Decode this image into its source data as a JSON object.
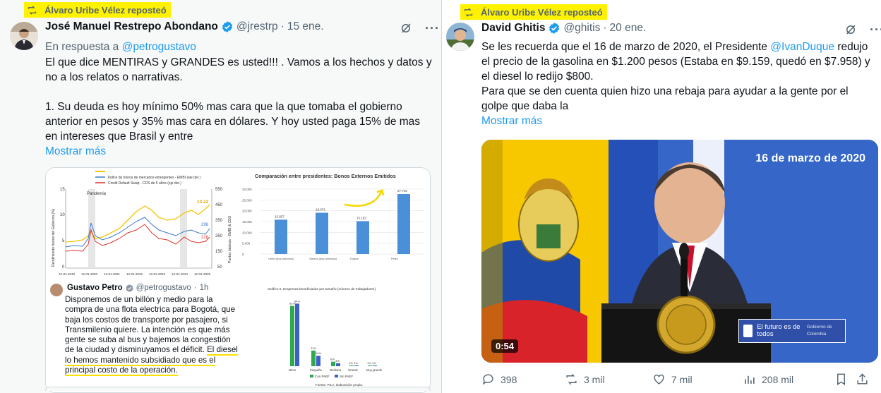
{
  "left_tweet": {
    "repost_label": "Álvaro Uribe Vélez reposteó",
    "author_name": "José Manuel Restrepo Abondano",
    "handle": "@jrestrp",
    "dot": "·",
    "date": "15 ene.",
    "reply_prefix": "En respuesta a",
    "reply_to": "@petrogustavo",
    "paragraph1": "El que dice MENTIRAS y GRANDES es usted!!! . Vamos a los hechos y datos y no a los relatos o narrativas.",
    "paragraph2": "1. Su deuda es hoy mínimo 50% mas cara que la que tomaba el gobierno anterior en pesos y 35% mas cara en dólares. Y hoy usted paga 15% de mas en intereses que Brasil y entre",
    "show_more": "Mostrar más",
    "media": {
      "line_chart": {
        "legend": [
          "Índice de bonos de mercados emergentes - EMBI (eje der.)",
          "Credit Default Swap - CDS de 5 años (eje der.)"
        ],
        "annotation": "Pandemia",
        "ylabel_left": "Rendimiento bonos del Gobierno (%)",
        "ylabel_right": "Puntos básicos - EMBI & CDS",
        "y_left_ticks": [
          "15",
          "10",
          "5",
          "0"
        ],
        "y_right_ticks": [
          "550",
          "450",
          "350",
          "250",
          "150",
          "50"
        ],
        "x_ticks": [
          "12-01-2019",
          "12-01-2020",
          "12-01-2021",
          "12-01-2022",
          "12-01-2023",
          "12-01-2024",
          "12-01-2025"
        ],
        "end_values": [
          "13.22",
          "296",
          "218"
        ]
      },
      "bar_chart": {
        "title": "Comparación entre presidentes:  Bonos Externos Emitidos",
        "categories": [
          "Uribe (dos periodos)",
          "Santos (dos periodos)",
          "Duque",
          "Petro"
        ],
        "value_labels": [
          "15.857",
          "19.072",
          "15.193",
          "27.715"
        ],
        "y_ticks": [
          "30.000",
          "25.000",
          "20.000",
          "15.000",
          "10.000",
          "5.000",
          "0"
        ]
      },
      "quoted": {
        "name": "Gustavo Petro",
        "handle": "@petrogustavo",
        "dot": "·",
        "date": "1h",
        "text_before": "Disponemos de un billón y medio para la compra de una flota electrica para Bogotá, que baja los costos de transporte por pasajero, si Transmilenio quiere. La intención es que más gente se suba al bus y bajemos la congestión de la ciudad y disminuyamos el déficit. ",
        "text_highlight": "El diesel lo hemos mantenido subsidiado que es el principal costo de la operación."
      },
      "small_bar_chart": {
        "title": "Gráfico 5. Empresas beneficiarias por tamaño (número de trabajadores)",
        "categories": [
          "Micro",
          "Pequeña",
          "Mediana",
          "Grande",
          "Muy grande"
        ],
        "labels_a": [
          "81%",
          "21%",
          "6%",
          "1%",
          "1%"
        ],
        "labels_b": [
          "84%",
          "14%",
          "4%",
          "1%",
          "1%"
        ],
        "legend": [
          "Con PAEF",
          "Sin PAEF"
        ],
        "source": "Fuente: PILA, elaboración propia."
      }
    }
  },
  "right_tweet": {
    "repost_label": "Álvaro Uribe Vélez reposteó",
    "author_name": "David Ghitis",
    "handle": "@ghitis",
    "dot": "·",
    "date": "20 ene.",
    "line1_before": "Se les recuerda que el 16 de marzo de 2020, el Presidente ",
    "mention": "@IvanDuque",
    "line1_after": " redujo el precio de la gasolina en $1.200 pesos (Estaba en $9.159, quedó en $7.958) y el diesel lo redijo $800.",
    "paragraph2": "Para que se den cuenta quien hizo una rebaja para ayudar a la gente por el golpe que daba la",
    "show_more": "Mostrar más",
    "video": {
      "date_overlay": "16 de marzo de 2020",
      "duration": "0:54",
      "gov_text": "El futuro es de todos",
      "gov_sub": "Gobierno de Colombia"
    },
    "actions": {
      "replies": "398",
      "reposts": "3 mil",
      "likes": "7 mil",
      "views": "208 mil"
    }
  },
  "colors": {
    "highlight": "#fff200",
    "link": "#1d9bf0",
    "muted": "#536471",
    "bar_blue": "#4a90d9"
  }
}
